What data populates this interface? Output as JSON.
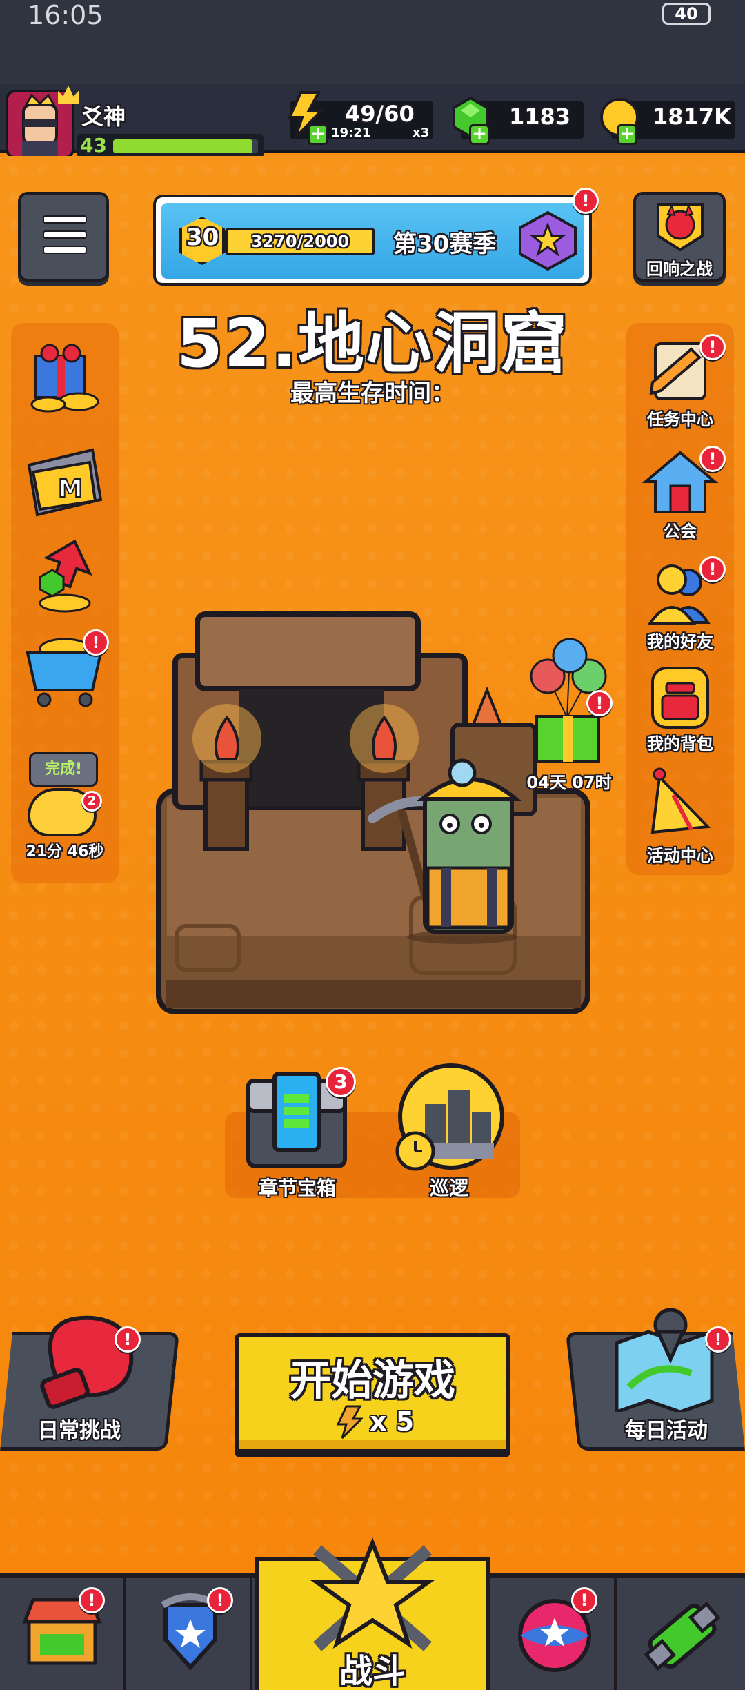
{
  "status_bar": {
    "time": "16:05",
    "battery": "40"
  },
  "player": {
    "name": "爻神",
    "level": "43"
  },
  "energy": {
    "value": "49/60",
    "timer": "19:21",
    "multiplier": "x3"
  },
  "gems": {
    "value": "1183"
  },
  "coins": {
    "value": "1817K"
  },
  "season": {
    "level": "30",
    "progress_text": "3270/2000",
    "title": "第30赛季"
  },
  "echo_battle": {
    "label": "回响之战"
  },
  "stage": {
    "title": "52.地心洞窟",
    "subtitle": "最高生存时间："
  },
  "left_side": {
    "piggy_bubble": "完成!",
    "piggy_timer": "21分 46秒"
  },
  "right_side": {
    "items": [
      {
        "label": "任务中心"
      },
      {
        "label": "公会"
      },
      {
        "label": "我的好友"
      },
      {
        "label": "我的背包"
      },
      {
        "label": "活动中心"
      }
    ]
  },
  "gift_timer": "04天 07时",
  "chapter_chest": {
    "label": "章节宝箱",
    "count": "3"
  },
  "patrol": {
    "label": "巡逻"
  },
  "daily_challenge": {
    "label": "日常挑战"
  },
  "start_game": {
    "label": "开始游戏",
    "cost": "x 5"
  },
  "daily_activity": {
    "label": "每日活动"
  },
  "bottom_nav": {
    "battle_label": "战斗"
  },
  "colors": {
    "background": "#f68f12",
    "badge": "#e8233a",
    "start_button": "#f7d21c",
    "topbar": "#2b2f3d"
  }
}
